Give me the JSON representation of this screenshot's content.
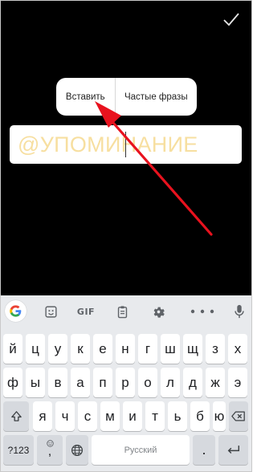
{
  "editor": {
    "mention_text": "@УПОМИНАНИЕ",
    "context_menu": {
      "paste_label": "Вставить",
      "phrases_label": "Частые фразы"
    },
    "arrow_color": "#e8121e",
    "mention_text_color": "#f7dfa0"
  },
  "keyboard": {
    "toolbar": {
      "icons": [
        "google-g-icon",
        "sticker-icon",
        "gif-icon",
        "clipboard-icon",
        "settings-gear-icon",
        "microphone-icon"
      ],
      "gif_label": "GIF"
    },
    "row1": [
      "й",
      "ц",
      "у",
      "к",
      "е",
      "н",
      "г",
      "ш",
      "щ",
      "з",
      "х"
    ],
    "row2": [
      "ф",
      "ы",
      "в",
      "а",
      "п",
      "р",
      "о",
      "л",
      "д",
      "ж",
      "э"
    ],
    "row3": [
      "я",
      "ч",
      "с",
      "м",
      "и",
      "т",
      "ь",
      "б",
      "ю"
    ],
    "symbols_label": "?123",
    "comma_label": ",",
    "space_label": "Русский",
    "period_label": "."
  }
}
